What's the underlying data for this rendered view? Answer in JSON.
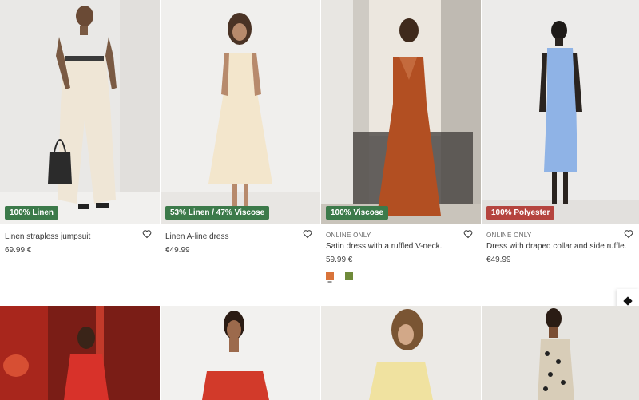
{
  "products": [
    {
      "badge": "100% Linen",
      "badge_color": "green",
      "online": "",
      "name": "Linen strapless jumpsuit",
      "price": "69.99 €"
    },
    {
      "badge": "53% Linen / 47% Viscose",
      "badge_color": "green",
      "online": "",
      "name": "Linen A-line dress",
      "price": "€49.99"
    },
    {
      "badge": "100% Viscose",
      "badge_color": "green",
      "online": "ONLINE ONLY",
      "name": "Satin dress with a ruffled V-neck.",
      "price": "59.99 €",
      "swatches": [
        "#d9733a",
        "#6f8a3a"
      ]
    },
    {
      "badge": "100% Polyester",
      "badge_color": "red",
      "online": "ONLINE ONLY",
      "name": "Dress with draped collar and side ruffle.",
      "price": "€49.99"
    }
  ],
  "colors": {
    "badge_green": "#3c7a4a",
    "badge_red": "#b5443e"
  },
  "icons": {
    "favorite": "heart-outline-icon",
    "scroll_widget": "diamond-icon"
  }
}
